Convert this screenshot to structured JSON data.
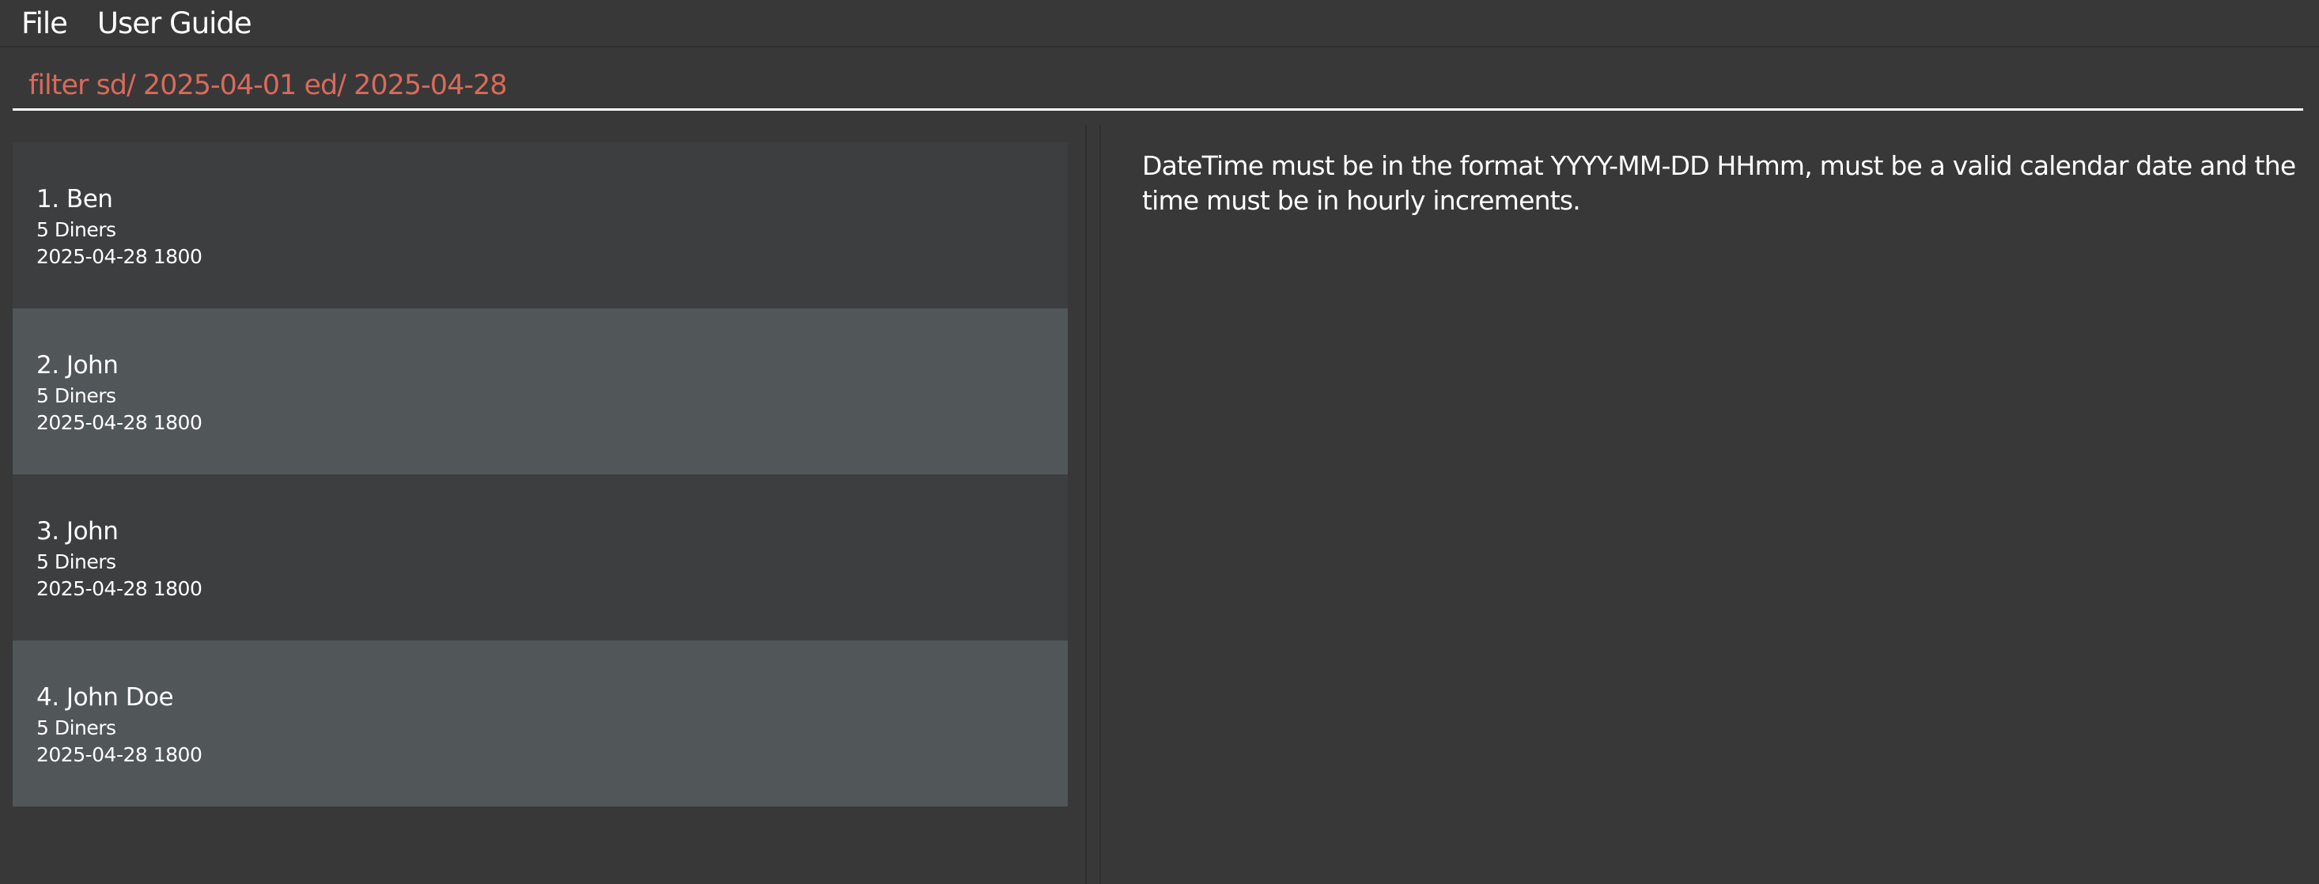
{
  "menubar": {
    "file_label": "File",
    "user_guide_label": "User Guide"
  },
  "command": {
    "value": "filter sd/ 2025-04-01 ed/ 2025-04-28",
    "text_color": "#d96a5a"
  },
  "reservations": [
    {
      "name": "1. Ben",
      "diners": "5 Diners",
      "datetime": "2025-04-28 1800"
    },
    {
      "name": "2. John",
      "diners": "5 Diners",
      "datetime": "2025-04-28 1800"
    },
    {
      "name": "3. John",
      "diners": "5 Diners",
      "datetime": "2025-04-28 1800"
    },
    {
      "name": "4. John Doe",
      "diners": "5 Diners",
      "datetime": "2025-04-28 1800"
    }
  ],
  "result": {
    "message": "DateTime must be in the format YYYY-MM-DD HHmm, must be a valid calendar date and the time must be in hourly increments."
  },
  "colors": {
    "background": "#383838",
    "card_odd": "#3c3e3f",
    "card_even": "#515658",
    "error_text": "#d96a5a"
  }
}
